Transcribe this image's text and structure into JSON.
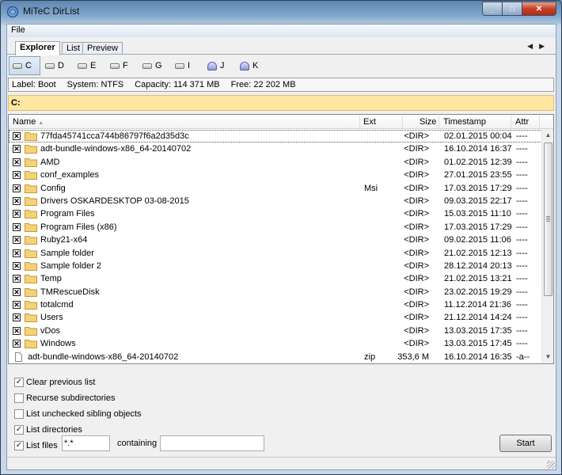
{
  "window": {
    "title": "MiTeC DirList",
    "min": "_",
    "max": "□",
    "close": "✕"
  },
  "menu": {
    "file": "File"
  },
  "tabs": [
    {
      "label": "Explorer",
      "active": true
    },
    {
      "label": "List",
      "active": false
    },
    {
      "label": "Preview",
      "active": false
    }
  ],
  "tab_scroll": {
    "left": "◀",
    "right": "▶"
  },
  "drives": [
    {
      "label": "C",
      "icon": "hdd-icon",
      "active": true
    },
    {
      "label": "D",
      "icon": "hdd-icon"
    },
    {
      "label": "E",
      "icon": "hdd-icon"
    },
    {
      "label": "F",
      "icon": "hdd-icon"
    },
    {
      "label": "G",
      "icon": "hdd-icon"
    },
    {
      "label": "I",
      "icon": "hdd-icon"
    },
    {
      "label": "J",
      "icon": "network-drive-icon"
    },
    {
      "label": "K",
      "icon": "network-drive-icon"
    }
  ],
  "info": {
    "label": "Label: Boot",
    "system": "System: NTFS",
    "capacity": "Capacity: 114 371 MB",
    "free": "Free: 22 202 MB"
  },
  "path": "C:",
  "list": {
    "columns": {
      "name": "Name",
      "ext": "Ext",
      "size": "Size",
      "timestamp": "Timestamp",
      "attr": "Attr"
    },
    "sort_indicator": "▲",
    "rows": [
      {
        "checked": "✕",
        "name": "77fda45741cca744b86797f6a2d35d3c",
        "ext": "",
        "size": "<DIR>",
        "time": "02.01.2015 00:04",
        "attr": "----",
        "type": "folder"
      },
      {
        "checked": "✕",
        "name": "adt-bundle-windows-x86_64-20140702",
        "ext": "",
        "size": "<DIR>",
        "time": "16.10.2014 16:37",
        "attr": "----",
        "type": "folder"
      },
      {
        "checked": "✕",
        "name": "AMD",
        "ext": "",
        "size": "<DIR>",
        "time": "01.02.2015 12:39",
        "attr": "----",
        "type": "folder"
      },
      {
        "checked": "✕",
        "name": "conf_examples",
        "ext": "",
        "size": "<DIR>",
        "time": "27.01.2015 23:55",
        "attr": "----",
        "type": "folder"
      },
      {
        "checked": "✕",
        "name": "Config",
        "ext": "Msi",
        "size": "<DIR>",
        "time": "17.03.2015 17:29",
        "attr": "----",
        "type": "folder"
      },
      {
        "checked": "✕",
        "name": "Drivers OSKARDESKTOP 03-08-2015",
        "ext": "",
        "size": "<DIR>",
        "time": "09.03.2015 22:17",
        "attr": "----",
        "type": "folder"
      },
      {
        "checked": "✕",
        "name": "Program Files",
        "ext": "",
        "size": "<DIR>",
        "time": "15.03.2015 11:10",
        "attr": "----",
        "type": "folder"
      },
      {
        "checked": "✕",
        "name": "Program Files (x86)",
        "ext": "",
        "size": "<DIR>",
        "time": "17.03.2015 17:29",
        "attr": "----",
        "type": "folder"
      },
      {
        "checked": "✕",
        "name": "Ruby21-x64",
        "ext": "",
        "size": "<DIR>",
        "time": "09.02.2015 11:06",
        "attr": "----",
        "type": "folder"
      },
      {
        "checked": "✕",
        "name": "Sample folder",
        "ext": "",
        "size": "<DIR>",
        "time": "21.02.2015 12:13",
        "attr": "----",
        "type": "folder"
      },
      {
        "checked": "✕",
        "name": "Sample folder 2",
        "ext": "",
        "size": "<DIR>",
        "time": "28.12.2014 20:13",
        "attr": "----",
        "type": "folder"
      },
      {
        "checked": "✕",
        "name": "Temp",
        "ext": "",
        "size": "<DIR>",
        "time": "21.02.2015 13:21",
        "attr": "----",
        "type": "folder"
      },
      {
        "checked": "✕",
        "name": "TMRescueDisk",
        "ext": "",
        "size": "<DIR>",
        "time": "23.02.2015 19:29",
        "attr": "----",
        "type": "folder"
      },
      {
        "checked": "✕",
        "name": "totalcmd",
        "ext": "",
        "size": "<DIR>",
        "time": "11.12.2014 21:36",
        "attr": "----",
        "type": "folder"
      },
      {
        "checked": "✕",
        "name": "Users",
        "ext": "",
        "size": "<DIR>",
        "time": "21.12.2014 14:24",
        "attr": "----",
        "type": "folder"
      },
      {
        "checked": "✕",
        "name": "vDos",
        "ext": "",
        "size": "<DIR>",
        "time": "13.03.2015 17:35",
        "attr": "----",
        "type": "folder"
      },
      {
        "checked": "✕",
        "name": "Windows",
        "ext": "",
        "size": "<DIR>",
        "time": "13.03.2015 17:45",
        "attr": "----",
        "type": "folder"
      },
      {
        "checked": "",
        "name": "adt-bundle-windows-x86_64-20140702",
        "ext": "zip",
        "size": "353,6 M",
        "time": "16.10.2014 16:35",
        "attr": "-a--",
        "type": "file"
      }
    ]
  },
  "scroll": {
    "up": "▲",
    "down": "▼"
  },
  "options": {
    "clear_previous": {
      "label": "Clear previous list",
      "checked": "✓"
    },
    "recurse": {
      "label": "Recurse subdirectories",
      "checked": ""
    },
    "unchecked_siblings": {
      "label": "List unchecked sibling objects",
      "checked": ""
    },
    "list_directories": {
      "label": "List directories",
      "checked": "✓"
    },
    "list_files": {
      "label": "List files",
      "checked": "✓"
    },
    "mask_value": "*.*",
    "containing_label": "containing",
    "containing_value": ""
  },
  "start_label": "Start"
}
